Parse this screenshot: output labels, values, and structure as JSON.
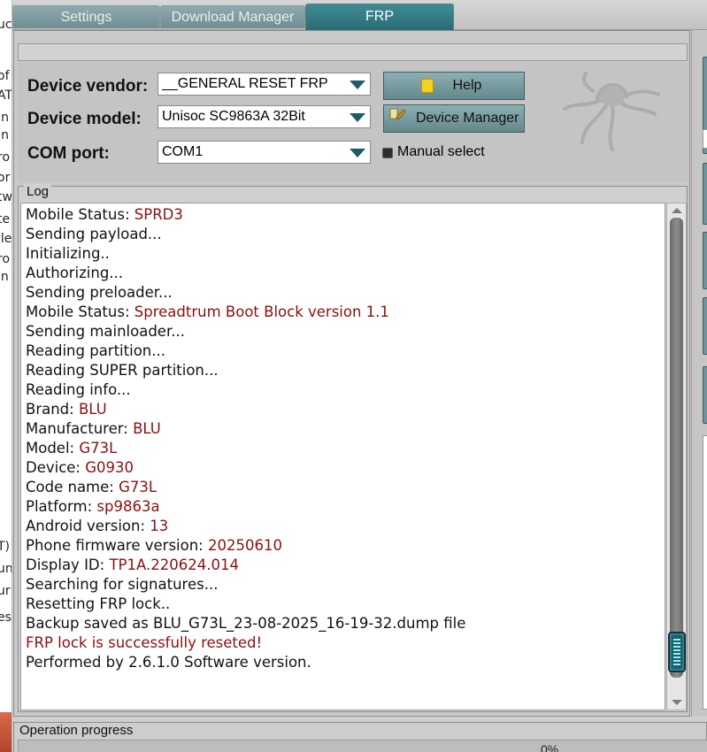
{
  "left_sliver_fragments": [
    "uc",
    "of",
    "AT",
    "In",
    "In",
    "ro",
    "or",
    "tw",
    "te",
    "ile",
    "ro",
    "in",
    "T)",
    "un",
    "ur",
    "es"
  ],
  "tabs": [
    {
      "label": "Settings",
      "active": false
    },
    {
      "label": "Download Manager",
      "active": false
    },
    {
      "label": "FRP",
      "active": true
    }
  ],
  "config": {
    "vendor_label": "Device vendor:",
    "vendor_value": "__GENERAL RESET FRP MI",
    "model_label": "Device model:",
    "model_value": "Unisoc SC9863A 32Bit",
    "com_label": "COM port:",
    "com_value": "COM1",
    "help_button": "Help",
    "device_manager_button": "Device Manager",
    "manual_select_label": "Manual select",
    "manual_select_checked": false
  },
  "log": {
    "title": "Log",
    "lines": [
      {
        "text": "Mobile Status: ",
        "value": "SPRD3"
      },
      {
        "text": "Sending payload...",
        "value": ""
      },
      {
        "text": "Initializing..",
        "value": ""
      },
      {
        "text": "Authorizing...",
        "value": ""
      },
      {
        "text": "Sending preloader...",
        "value": ""
      },
      {
        "text": "Mobile Status: ",
        "value": "Spreadtrum Boot Block version 1.1"
      },
      {
        "text": "Sending mainloader...",
        "value": ""
      },
      {
        "text": "Reading partition...",
        "value": ""
      },
      {
        "text": "Reading SUPER partition...",
        "value": ""
      },
      {
        "text": "Reading info...",
        "value": ""
      },
      {
        "text": "Brand: ",
        "value": "BLU"
      },
      {
        "text": "Manufacturer: ",
        "value": "BLU"
      },
      {
        "text": "Model: ",
        "value": "G73L"
      },
      {
        "text": "Device: ",
        "value": "G0930"
      },
      {
        "text": "Code name: ",
        "value": "G73L"
      },
      {
        "text": "Platform: ",
        "value": "sp9863a"
      },
      {
        "text": "Android version: ",
        "value": "13"
      },
      {
        "text": "Phone firmware version: ",
        "value": "20250610"
      },
      {
        "text": "Display ID: ",
        "value": "TP1A.220624.014"
      },
      {
        "text": "Searching for signatures...",
        "value": ""
      },
      {
        "text": "Resetting FRP lock..",
        "value": ""
      },
      {
        "text": "Backup saved as BLU_G73L_23-08-2025_16-19-32.dump file",
        "value": ""
      },
      {
        "text": "",
        "value": "FRP lock is successfully reseted!"
      },
      {
        "text": "Performed by 2.6.1.0 Software version.",
        "value": ""
      }
    ],
    "scroll_position": 0.96
  },
  "progress": {
    "title": "Operation progress",
    "percent_label": "0%",
    "value": 0
  },
  "icons": {
    "help": "help-book-icon",
    "device_manager": "device-manager-icon",
    "logo": "octopus-logo-icon"
  },
  "colors": {
    "accent": "#2a6b74",
    "value_text": "#8a1010"
  }
}
